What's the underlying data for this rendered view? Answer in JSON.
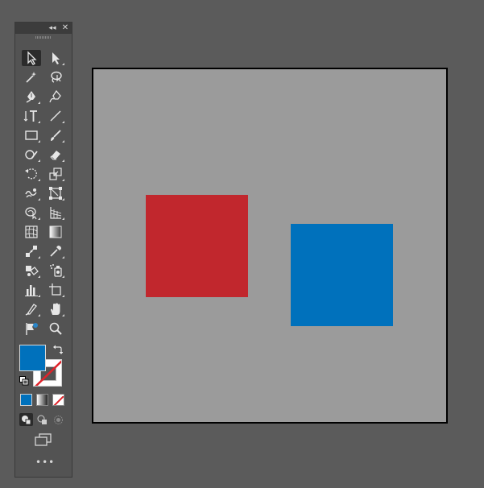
{
  "toolbar": {
    "collapse_glyph": "◂◂",
    "close_glyph": "✕",
    "more_glyph": "•••",
    "tools": [
      {
        "name": "selection-tool",
        "icon": "arrow-icon",
        "active": true
      },
      {
        "name": "direct-selection-tool",
        "icon": "white-arrow-icon"
      },
      {
        "name": "magic-wand-tool",
        "icon": "magic-wand-icon"
      },
      {
        "name": "lasso-tool",
        "icon": "lasso-icon"
      },
      {
        "name": "pen-tool",
        "icon": "pen-icon"
      },
      {
        "name": "curvature-tool",
        "icon": "curvature-pen-icon"
      },
      {
        "name": "type-tool",
        "icon": "type-icon"
      },
      {
        "name": "line-segment-tool",
        "icon": "line-icon"
      },
      {
        "name": "rectangle-tool",
        "icon": "rectangle-icon"
      },
      {
        "name": "paintbrush-tool",
        "icon": "brush-icon"
      },
      {
        "name": "shaper-tool",
        "icon": "shaper-icon"
      },
      {
        "name": "eraser-tool",
        "icon": "eraser-icon"
      },
      {
        "name": "rotate-tool",
        "icon": "rotate-icon"
      },
      {
        "name": "scale-tool",
        "icon": "scale-icon"
      },
      {
        "name": "warp-tool",
        "icon": "warp-icon"
      },
      {
        "name": "free-transform-tool",
        "icon": "free-transform-icon"
      },
      {
        "name": "shape-builder-tool",
        "icon": "shape-builder-icon"
      },
      {
        "name": "perspective-grid-tool",
        "icon": "perspective-grid-icon"
      },
      {
        "name": "mesh-tool",
        "icon": "mesh-icon"
      },
      {
        "name": "gradient-tool",
        "icon": "gradient-icon"
      },
      {
        "name": "blend-tool",
        "icon": "blend-icon"
      },
      {
        "name": "eyedropper-tool",
        "icon": "eyedropper-icon"
      },
      {
        "name": "live-paint-bucket-tool",
        "icon": "live-paint-icon"
      },
      {
        "name": "symbol-sprayer-tool",
        "icon": "symbol-sprayer-icon"
      },
      {
        "name": "column-graph-tool",
        "icon": "bar-graph-icon"
      },
      {
        "name": "artboard-tool",
        "icon": "artboard-icon"
      },
      {
        "name": "slice-tool",
        "icon": "slice-knife-icon"
      },
      {
        "name": "hand-tool",
        "icon": "hand-icon"
      },
      {
        "name": "puppet-warp-tool",
        "icon": "puppet-warp-icon"
      },
      {
        "name": "zoom-tool",
        "icon": "magnifier-icon"
      }
    ]
  },
  "colors": {
    "fill": "#0071bc",
    "stroke": "none",
    "panel": "#535353",
    "canvas_bg": "#5b5b5b",
    "artboard_bg": "#9b9b9b"
  },
  "artboard": {
    "objects": [
      {
        "name": "red-square",
        "color": "#c1272d"
      },
      {
        "name": "blue-square",
        "color": "#0071bc"
      }
    ]
  }
}
